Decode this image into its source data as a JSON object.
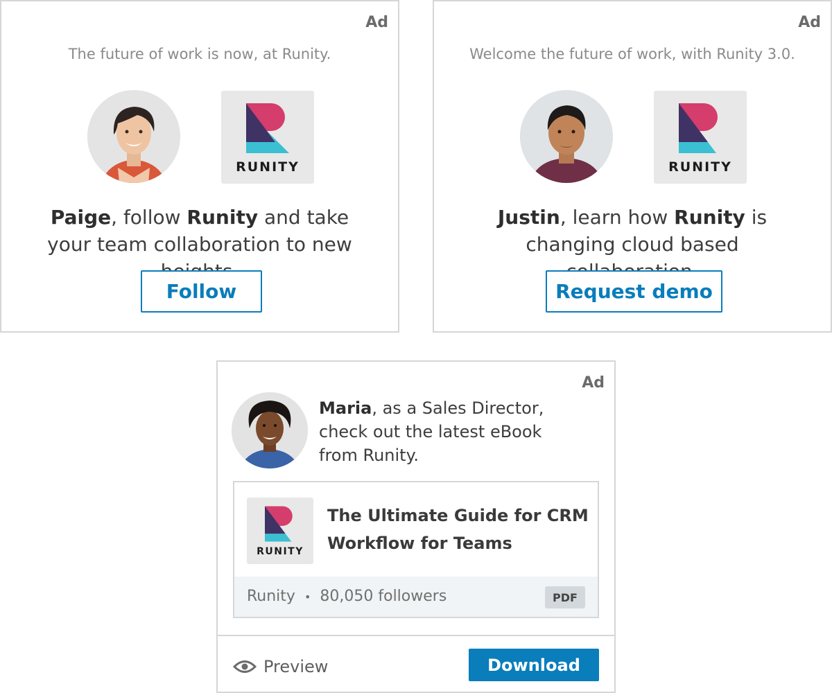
{
  "colors": {
    "accent": "#0a7dbb",
    "logo_pink": "#d43d6c",
    "logo_navy": "#3f3265",
    "logo_teal": "#3bbfd3"
  },
  "ad_one": {
    "ad_label": "Ad",
    "tagline": "The future of work is now, at Runity.",
    "avatar_icon": "woman-portrait-avatar",
    "logo_text": "RUNITY",
    "message": {
      "name": "Paige",
      "part1": ", follow ",
      "brand": "Runity",
      "part2": " and take your team collaboration to new heights."
    },
    "button_label": "Follow"
  },
  "ad_two": {
    "ad_label": "Ad",
    "tagline": "Welcome the future of work, with Runity 3.0.",
    "avatar_icon": "man-portrait-avatar",
    "logo_text": "RUNITY",
    "message": {
      "name": "Justin",
      "part1": ", learn how ",
      "brand": "Runity",
      "part2": " is changing cloud based collaboration."
    },
    "button_label": "Request demo"
  },
  "ad_three": {
    "ad_label": "Ad",
    "avatar_icon": "woman-portrait-avatar",
    "message": {
      "name": "Maria",
      "line1": ", as a Sales Director,",
      "line2": "check out the latest eBook",
      "line3": "from Runity."
    },
    "logo_text": "RUNITY",
    "doc_title_line1": "The Ultimate Guide for CRM",
    "doc_title_line2": "Workflow for Teams",
    "company": "Runity",
    "separator": "•",
    "followers": "80,050 followers",
    "file_type": "PDF",
    "preview_icon": "eye-icon",
    "preview_label": "Preview",
    "download_label": "Download"
  }
}
